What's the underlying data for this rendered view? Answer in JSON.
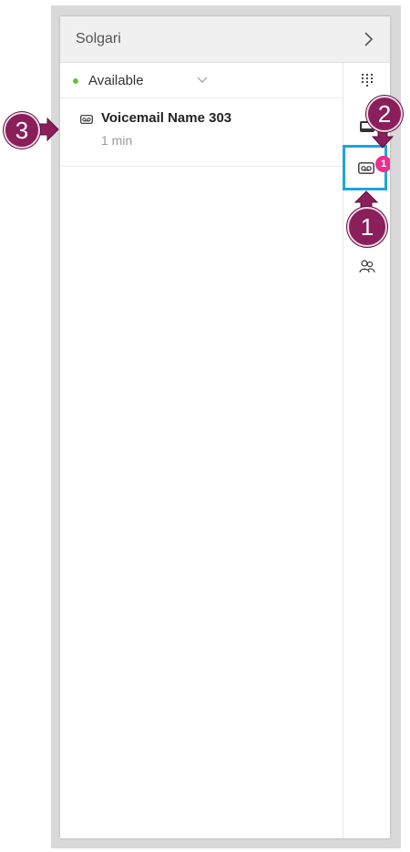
{
  "header": {
    "title": "Solgari"
  },
  "status": {
    "label": "Available",
    "color": "#6bbf3a"
  },
  "voicemails": [
    {
      "name": "Voicemail Name 303",
      "time": "1 min"
    }
  ],
  "rail": {
    "voicemail_badge": "1",
    "items": [
      "dialpad-icon",
      "inbox-icon",
      "voicemail-icon",
      "contacts-icon"
    ]
  },
  "callouts": {
    "first": "1",
    "second": "2",
    "third": "3"
  },
  "colors": {
    "accent": "#1ba6dc",
    "badge": "#e8318f",
    "callout": "#8a1f5c"
  }
}
